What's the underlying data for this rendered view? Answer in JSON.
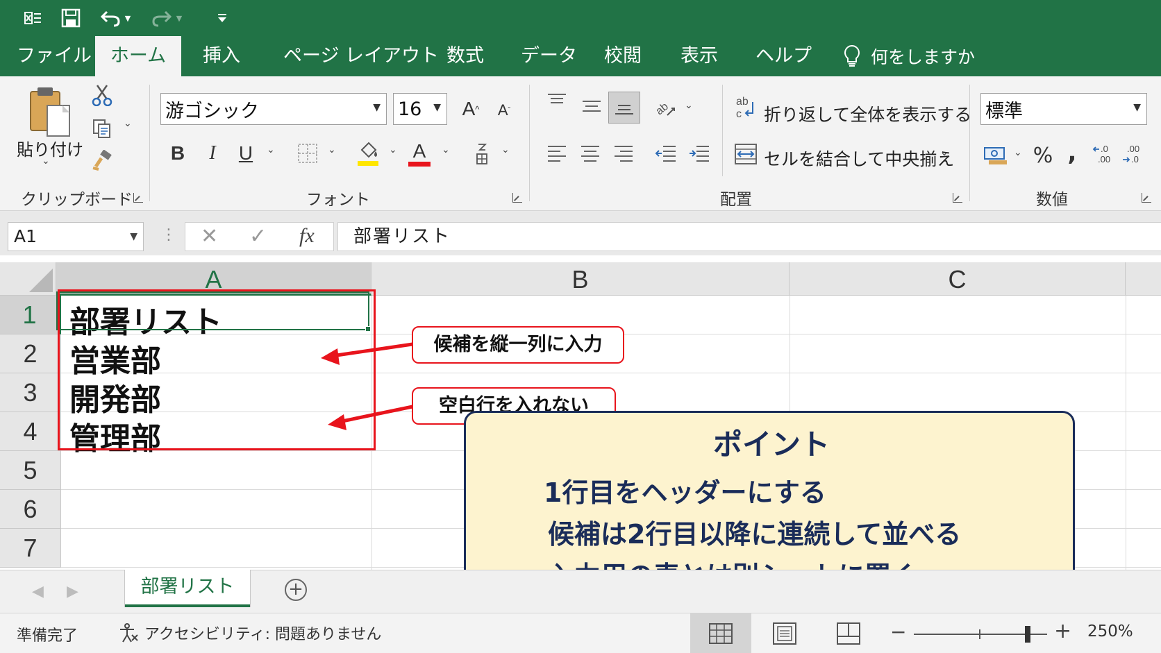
{
  "tabs": [
    "ファイル",
    "ホーム",
    "挿入",
    "ページ レイアウト",
    "数式",
    "データ",
    "校閲",
    "表示",
    "ヘルプ"
  ],
  "tell_me": "何をしますか",
  "ribbon": {
    "clipboard": {
      "paste_label": "貼り付け",
      "group_label": "クリップボード"
    },
    "font": {
      "font_name": "游ゴシック",
      "font_size": "16",
      "group_label": "フォント",
      "bold": "B",
      "italic": "I",
      "underline": "U",
      "font_color_glyph": "A"
    },
    "alignment": {
      "wrap_text": "折り返して全体を表示する",
      "merge_center": "セルを結合して中央揃え",
      "group_label": "配置"
    },
    "number": {
      "format": "標準",
      "group_label": "数値",
      "percent": "%",
      "comma": ","
    }
  },
  "formula_bar": {
    "name_box": "A1",
    "fx": "fx",
    "value": "部署リスト"
  },
  "columns": [
    "A",
    "B",
    "C"
  ],
  "rows": [
    "1",
    "2",
    "3",
    "4",
    "5",
    "6",
    "7"
  ],
  "cells": {
    "A1": "部署リスト",
    "A2": "営業部",
    "A3": "開発部",
    "A4": "管理部"
  },
  "callouts": [
    "候補を縦一列に入力",
    "空白行を入れない"
  ],
  "point_box": {
    "title": "ポイント",
    "lines": [
      "1行目をヘッダーにする",
      "候補は2行目以降に連続して並べる",
      "入力用の表とは別シートに置く"
    ]
  },
  "sheet_tab": "部署リスト",
  "status": {
    "ready": "準備完了",
    "accessibility": "アクセシビリティ: 問題ありません",
    "zoom": "250%"
  },
  "colors": {
    "excel_green": "#217346",
    "callout_red": "#e8141c",
    "point_bg": "#fdf3cf",
    "point_text": "#1a2c59"
  }
}
